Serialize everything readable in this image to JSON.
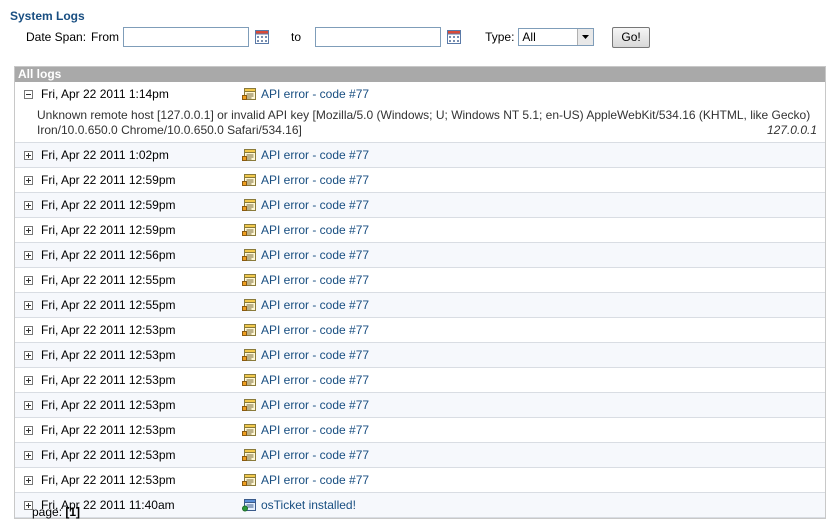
{
  "page": {
    "title": "System Logs"
  },
  "filters": {
    "date_span_label": "Date Span:",
    "from_label": "From",
    "from_value": "",
    "to_label": "to",
    "to_value": "",
    "type_label": "Type:",
    "type_selected": "All",
    "go_label": "Go!"
  },
  "table": {
    "header": "All logs",
    "rows": [
      {
        "date": "Fri, Apr 22 2011 1:14pm",
        "title": "API error - code #77",
        "expanded": true,
        "detail": "Unknown remote host [127.0.0.1] or invalid API key [Mozilla/5.0 (Windows; U; Windows NT 5.1; en-US) AppleWebKit/534.16 (KHTML, like Gecko) Iron/10.0.650.0 Chrome/10.0.650.0 Safari/534.16]",
        "ip": "127.0.0.1"
      },
      {
        "date": "Fri, Apr 22 2011 1:02pm",
        "title": "API error - code #77"
      },
      {
        "date": "Fri, Apr 22 2011 12:59pm",
        "title": "API error - code #77"
      },
      {
        "date": "Fri, Apr 22 2011 12:59pm",
        "title": "API error - code #77"
      },
      {
        "date": "Fri, Apr 22 2011 12:59pm",
        "title": "API error - code #77"
      },
      {
        "date": "Fri, Apr 22 2011 12:56pm",
        "title": "API error - code #77"
      },
      {
        "date": "Fri, Apr 22 2011 12:55pm",
        "title": "API error - code #77"
      },
      {
        "date": "Fri, Apr 22 2011 12:55pm",
        "title": "API error - code #77"
      },
      {
        "date": "Fri, Apr 22 2011 12:53pm",
        "title": "API error - code #77"
      },
      {
        "date": "Fri, Apr 22 2011 12:53pm",
        "title": "API error - code #77"
      },
      {
        "date": "Fri, Apr 22 2011 12:53pm",
        "title": "API error - code #77"
      },
      {
        "date": "Fri, Apr 22 2011 12:53pm",
        "title": "API error - code #77"
      },
      {
        "date": "Fri, Apr 22 2011 12:53pm",
        "title": "API error - code #77"
      },
      {
        "date": "Fri, Apr 22 2011 12:53pm",
        "title": "API error - code #77"
      },
      {
        "date": "Fri, Apr 22 2011 12:53pm",
        "title": "API error - code #77"
      },
      {
        "date": "Fri, Apr 22 2011 11:40am",
        "title": "osTicket installed!"
      }
    ]
  },
  "pager": {
    "label": "page:",
    "current": "[1]"
  },
  "icons": {
    "calendar": "calendar-icon",
    "log_error": "log-error-icon",
    "log_info": "log-info-icon"
  }
}
